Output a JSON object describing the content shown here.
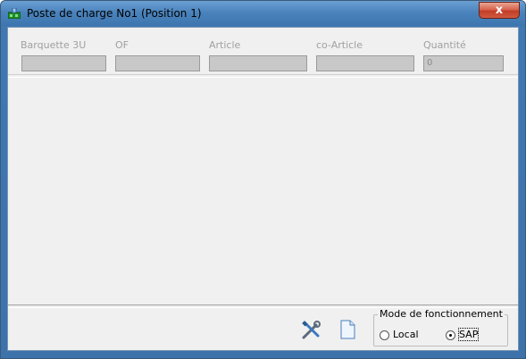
{
  "window": {
    "title": "Poste de charge No1 (Position 1)",
    "close_label": "x"
  },
  "fields": [
    {
      "label": "Barquette 3U",
      "value": ""
    },
    {
      "label": "OF",
      "value": ""
    },
    {
      "label": "Article",
      "value": ""
    },
    {
      "label": "co-Article",
      "value": ""
    },
    {
      "label": "Quantité",
      "value": "0"
    }
  ],
  "toolbar": {
    "settings_icon": "tools-icon",
    "document_icon": "document-icon"
  },
  "mode": {
    "legend": "Mode de fonctionnement",
    "options": [
      {
        "label": "Local",
        "selected": false
      },
      {
        "label": "SAP",
        "selected": true
      }
    ]
  },
  "colors": {
    "frame": "#3f78b3",
    "client_bg": "#f0f0f0",
    "disabled_field": "#c8c8c8",
    "disabled_text": "#a0a0a0",
    "close_button": "#c94a33"
  }
}
